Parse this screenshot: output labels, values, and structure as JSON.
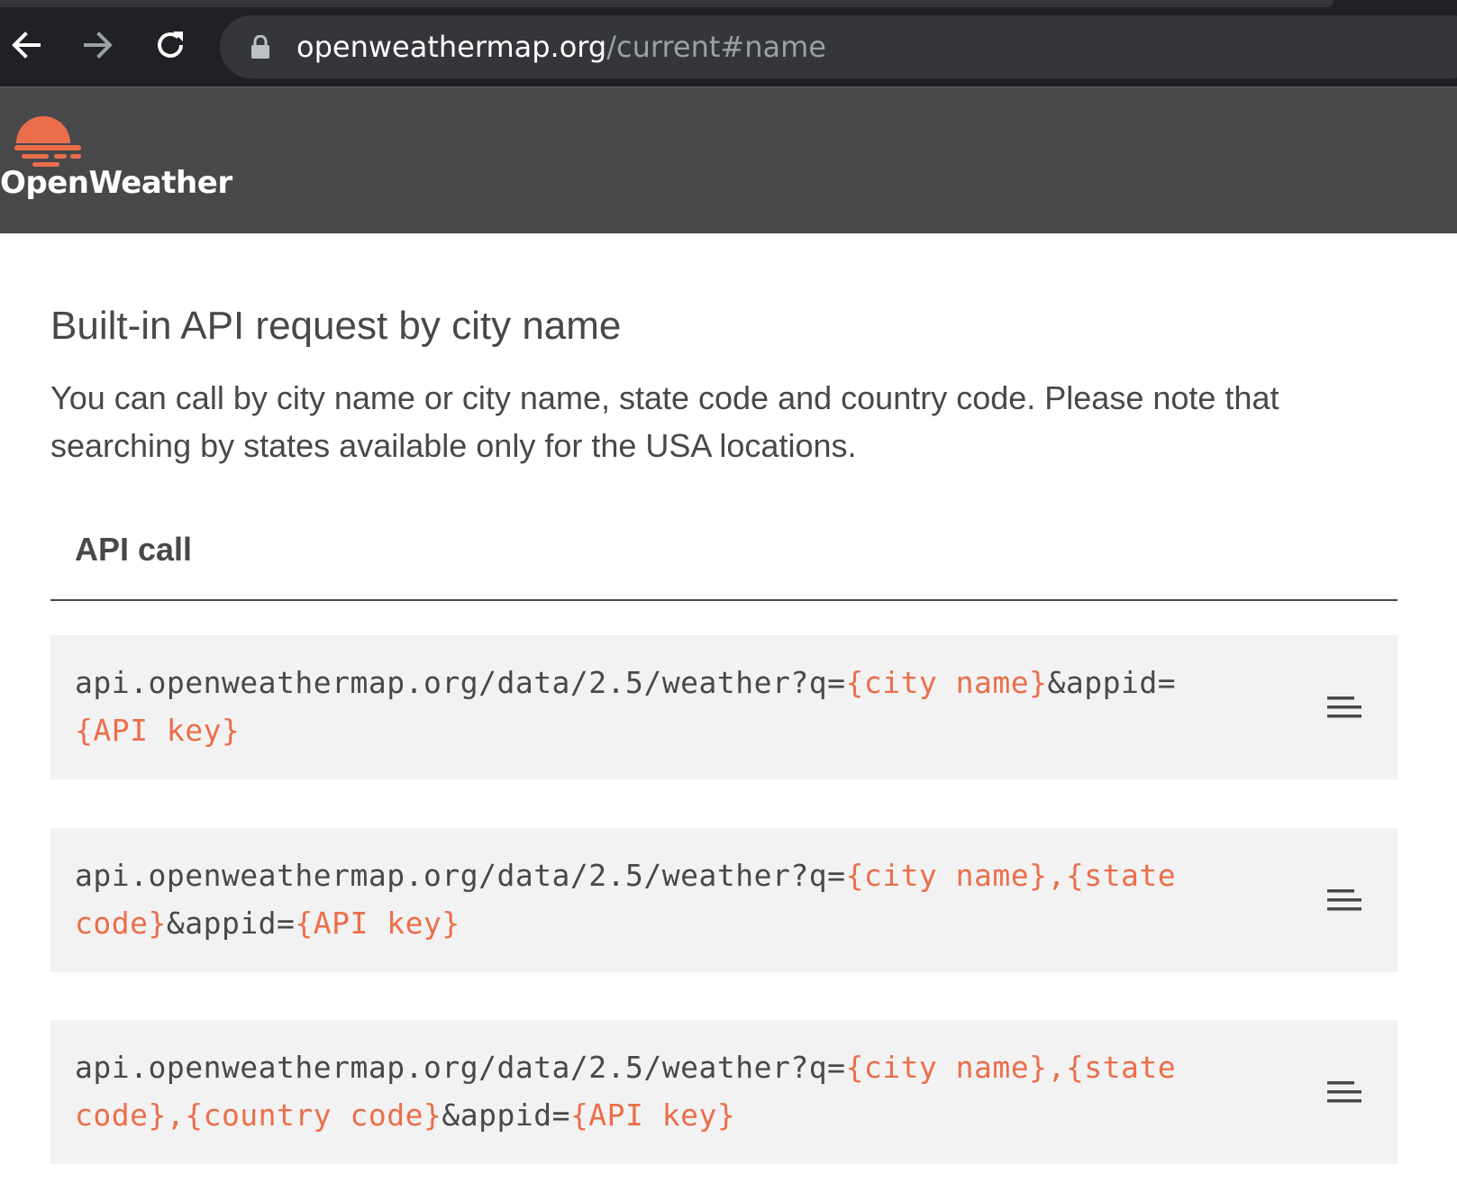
{
  "browser": {
    "url_host": "openweathermap.org",
    "url_path": "/current#name"
  },
  "header": {
    "logo_text": "OpenWeather"
  },
  "section": {
    "title": "Built-in API request by city name",
    "description": "You can call by city name or city name, state code and country code. Please note that searching by states available only for the USA locations.",
    "subtitle": "API call"
  },
  "code_blocks": [
    {
      "segments": [
        {
          "text": "api.openweathermap.org/data/2.5/weather?q=",
          "param": false
        },
        {
          "text": "{city name}",
          "param": true
        },
        {
          "text": "&appid=",
          "param": false
        },
        {
          "text": "{API key}",
          "param": true
        }
      ]
    },
    {
      "segments": [
        {
          "text": "api.openweathermap.org/data/2.5/weather?q=",
          "param": false
        },
        {
          "text": "{city name},{state code}",
          "param": true
        },
        {
          "text": "&appid=",
          "param": false
        },
        {
          "text": "{API key}",
          "param": true
        }
      ]
    },
    {
      "segments": [
        {
          "text": "api.openweathermap.org/data/2.5/weather?q=",
          "param": false
        },
        {
          "text": "{city name},{state code},{country code}",
          "param": true
        },
        {
          "text": "&appid=",
          "param": false
        },
        {
          "text": "{API key}",
          "param": true
        }
      ]
    }
  ],
  "colors": {
    "brand_orange": "#eb6e4b",
    "header_bg": "#48484a",
    "code_bg": "#f2f2f2"
  },
  "icons": {
    "back": "arrow-left-icon",
    "forward": "arrow-right-icon",
    "reload": "reload-icon",
    "lock": "lock-icon",
    "copy": "copy-lines-icon"
  }
}
